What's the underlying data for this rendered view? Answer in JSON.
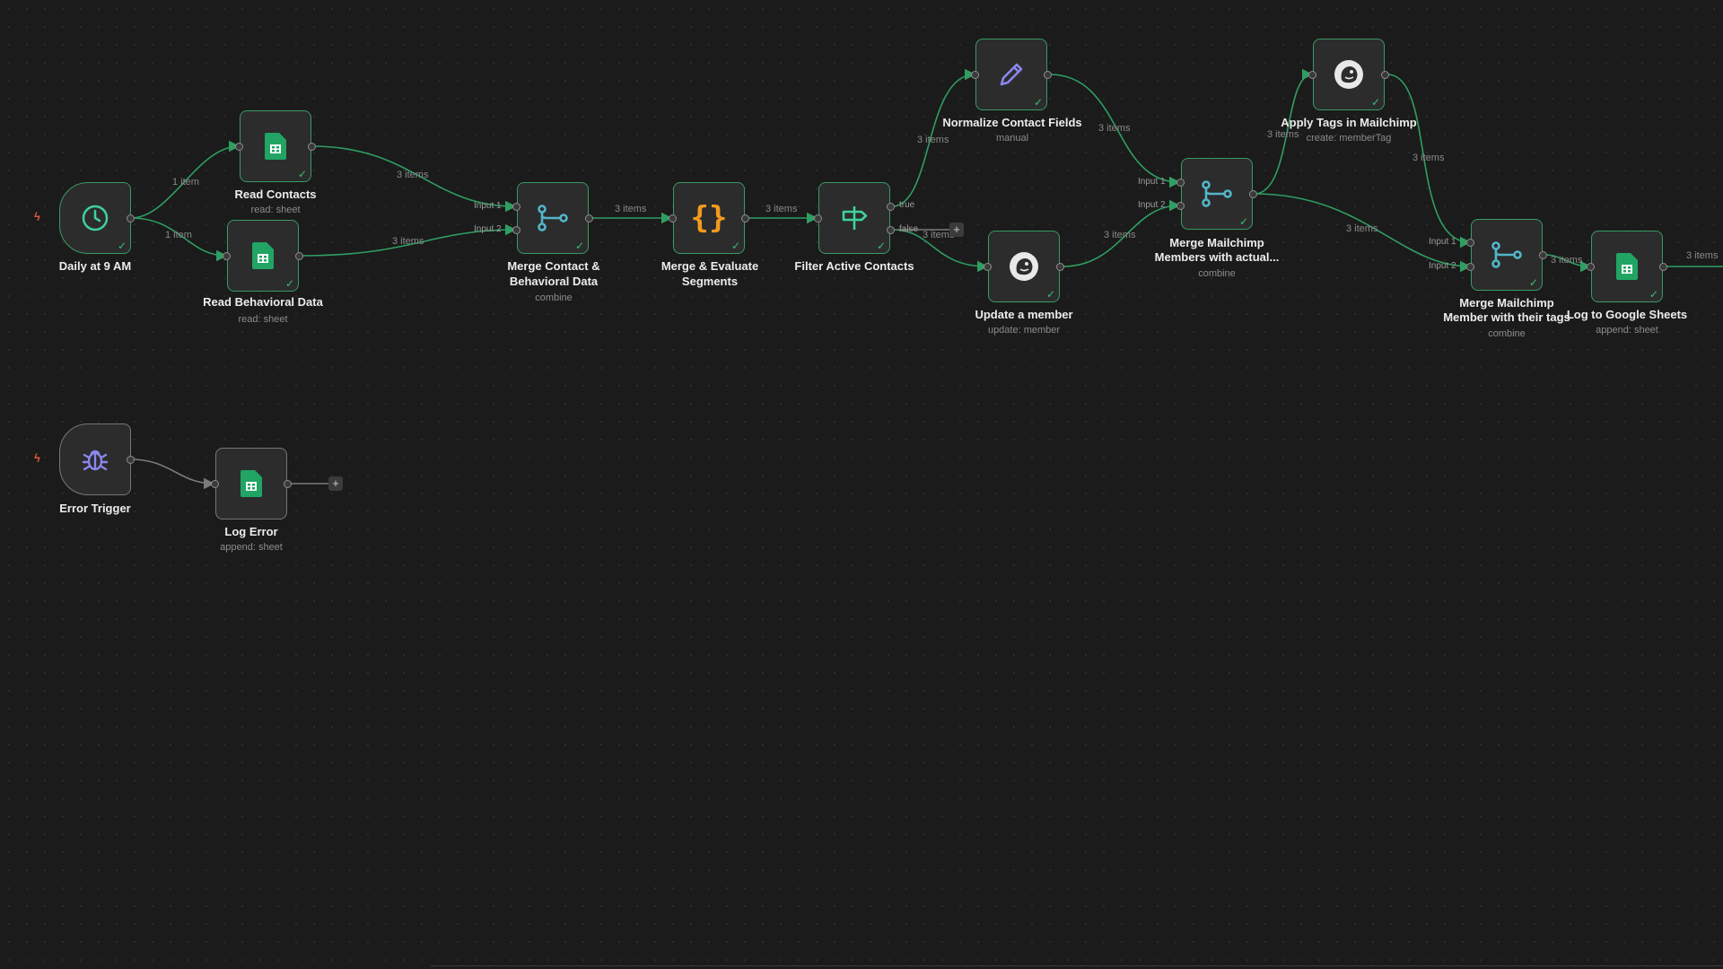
{
  "colors": {
    "edge": "#2f9e63",
    "node_border": "#3a9a64",
    "canvas": "#1b1b1b",
    "trigger_bolt": "#e2553f"
  },
  "nodes": {
    "daily": {
      "title": "Daily at 9 AM",
      "icon": "clock-icon"
    },
    "read_contacts": {
      "title": "Read Contacts",
      "sub": "read: sheet",
      "icon": "google-sheets-icon"
    },
    "read_behavioral": {
      "title": "Read Behavioral Data",
      "sub": "read: sheet",
      "icon": "google-sheets-icon"
    },
    "merge_contact": {
      "title1": "Merge Contact &",
      "title2": "Behavioral Data",
      "sub": "combine",
      "icon": "merge-icon"
    },
    "merge_evaluate": {
      "title1": "Merge & Evaluate",
      "title2": "Segments",
      "icon": "code-braces-icon"
    },
    "filter_active": {
      "title": "Filter Active Contacts",
      "icon": "signpost-icon",
      "port_true": "true",
      "port_false": "false"
    },
    "normalize": {
      "title": "Normalize Contact Fields",
      "sub": "manual",
      "icon": "pencil-icon"
    },
    "update_member": {
      "title": "Update a member",
      "sub": "update: member",
      "icon": "mailchimp-icon"
    },
    "merge_mailchimp": {
      "title1": "Merge Mailchimp",
      "title2": "Members with actual...",
      "sub": "combine",
      "icon": "merge-icon"
    },
    "apply_tags": {
      "title": "Apply Tags in Mailchimp",
      "sub": "create: memberTag",
      "icon": "mailchimp-icon"
    },
    "merge_member_tags": {
      "title1": "Merge Mailchimp",
      "title2": "Member with their tags",
      "sub": "combine",
      "icon": "merge-icon"
    },
    "log_sheets": {
      "title": "Log to Google Sheets",
      "sub": "append: sheet",
      "icon": "google-sheets-icon"
    },
    "error_trigger": {
      "title": "Error Trigger",
      "icon": "bug-icon"
    },
    "log_error": {
      "title": "Log Error",
      "sub": "append: sheet",
      "icon": "google-sheets-icon"
    }
  },
  "ports": {
    "input1": "Input 1",
    "input2": "Input 2"
  },
  "edge_labels": {
    "e1": "1 item",
    "e2": "1 item",
    "e3": "3 items",
    "e4": "3 items",
    "e5": "3 items",
    "e6": "3 items",
    "e7": "3 items",
    "e8": "3 items",
    "e9": "3 items",
    "e10": "3 items",
    "e11": "3 items",
    "e12": "3 items",
    "e13": "3 items",
    "e14": "3 items",
    "e15": "3 items"
  }
}
